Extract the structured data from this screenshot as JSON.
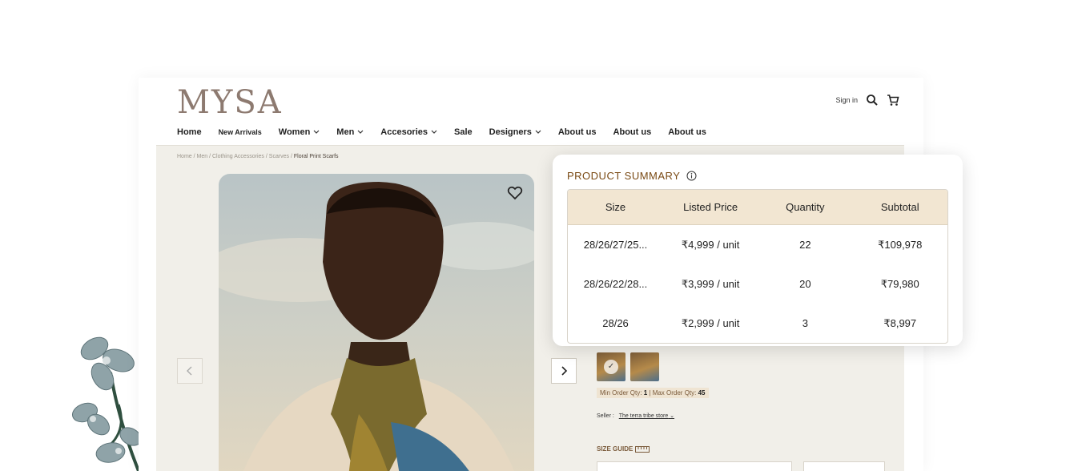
{
  "header": {
    "logo": "MYSA",
    "sign_in": "Sign in",
    "icons": {
      "search": "search-icon",
      "cart": "cart-icon"
    }
  },
  "nav": {
    "items": [
      {
        "label": "Home",
        "dropdown": false
      },
      {
        "label": "New Arrivals",
        "dropdown": false
      },
      {
        "label": "Women",
        "dropdown": true
      },
      {
        "label": "Men",
        "dropdown": true
      },
      {
        "label": "Accesories",
        "dropdown": true
      },
      {
        "label": "Sale",
        "dropdown": false
      },
      {
        "label": "Designers",
        "dropdown": true
      },
      {
        "label": "About us",
        "dropdown": false
      },
      {
        "label": "About us",
        "dropdown": false
      },
      {
        "label": "About us",
        "dropdown": false
      }
    ]
  },
  "breadcrumb": {
    "path": "Home / Men / Clothing Accessories / Scarves / ",
    "current": "Floral Print Scarfs"
  },
  "product": {
    "order_qty": {
      "min_label": "Min Order Qty:",
      "min": "1",
      "max_label": "Max Order Qty:",
      "max": "45"
    },
    "seller_label": "Seller :",
    "seller_name": "The terra tribe store",
    "size_guide": "SIZE GUIDE"
  },
  "summary": {
    "title": "PRODUCT SUMMARY",
    "columns": [
      "Size",
      "Listed Price",
      "Quantity",
      "Subtotal"
    ],
    "rows": [
      [
        "28/26/27/25...",
        "₹4,999 / unit",
        "22",
        "₹109,978"
      ],
      [
        "28/26/22/28...",
        "₹3,999 / unit",
        "20",
        "₹79,980"
      ],
      [
        "28/26",
        "₹2,999 / unit",
        "3",
        "₹8,997"
      ]
    ]
  },
  "colors": {
    "accent": "#7a4a14",
    "header_bg": "#f2e6d2",
    "page_bg": "#f1efe9",
    "logo": "#8d7a70"
  }
}
